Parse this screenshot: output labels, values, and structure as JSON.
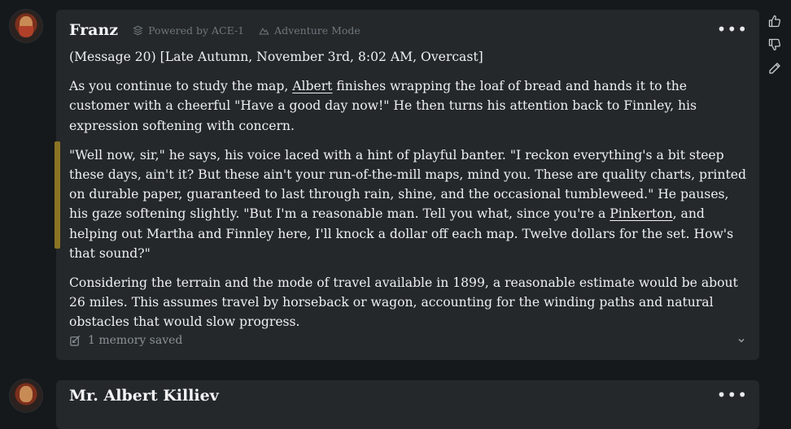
{
  "message": {
    "author": "Franz",
    "powered_by": "Powered by ACE-1",
    "mode": "Adventure Mode",
    "paragraphs": {
      "p1": "(Message 20) [Late Autumn, November 3rd, 8:02 AM, Overcast]",
      "p2_a": "As you continue to study the map, ",
      "p2_link": "Albert",
      "p2_b": " finishes wrapping the loaf of bread and hands it to the customer with a cheerful \"Have a good day now!\" He then turns his attention back to Finnley, his expression softening with concern.",
      "p3_a": "\"Well now, sir,\" he says, his voice laced with a hint of playful banter. \"I reckon everything's a bit steep these days, ain't it? But these ain't your run-of-the-mill maps, mind you. These are quality charts, printed on durable paper, guaranteed to last through rain, shine, and the occasional tumbleweed.\" He pauses, his gaze softening slightly. \"But I'm a reasonable man. Tell you what, since you're a ",
      "p3_link": "Pinkerton",
      "p3_b": ", and helping out Martha and Finnley here, I'll knock a dollar off each map. Twelve dollars for the set. How's that sound?\"",
      "p4": "Considering the terrain and the mode of travel available in 1899, a reasonable estimate would be about 26 miles. This assumes travel by horseback or wagon, accounting for the winding paths and natural obstacles that would slow progress."
    },
    "memory": "1 memory saved",
    "more": "•••"
  },
  "next_message": {
    "author": "Mr. Albert Killiev",
    "more": "•••"
  },
  "colors": {
    "background": "#15191c",
    "card": "#24282b",
    "quote_bar": "#8a7424"
  }
}
